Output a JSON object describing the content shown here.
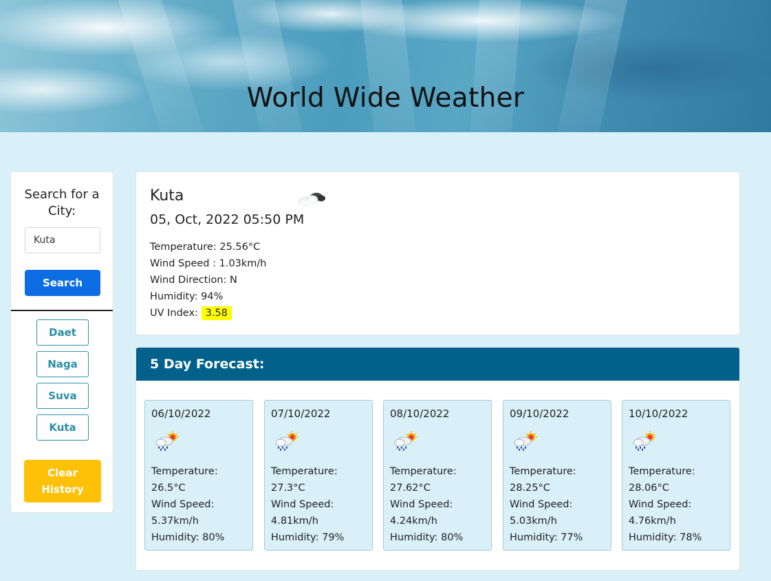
{
  "header": {
    "title": "World Wide Weather"
  },
  "sidebar": {
    "heading": "Search for a City:",
    "search_value": "Kuta",
    "search_button": "Search",
    "history": [
      "Daet",
      "Naga",
      "Suva",
      "Kuta"
    ],
    "clear_button": "Clear History"
  },
  "current": {
    "city": "Kuta",
    "date": "05, Oct, 2022 05:50 PM",
    "icon": "cloudy-icon",
    "temperature": "Temperature: 25.56°C",
    "wind_speed": "Wind Speed : 1.03km/h",
    "wind_direction": "Wind Direction: N",
    "humidity": "Humidity: 94%",
    "uv_label": "UV Index:",
    "uv_value": "3.58",
    "uv_color": "#ffff00"
  },
  "forecast": {
    "title": "5 Day Forecast:",
    "days": [
      {
        "date": "06/10/2022",
        "icon": "rain-sun-icon",
        "temp_label": "Temperature:",
        "temp": "26.5°C",
        "wind_label": "Wind Speed:",
        "wind": "5.37km/h",
        "humidity": "Humidity: 80%"
      },
      {
        "date": "07/10/2022",
        "icon": "rain-sun-icon",
        "temp_label": "Temperature:",
        "temp": "27.3°C",
        "wind_label": "Wind Speed:",
        "wind": "4.81km/h",
        "humidity": "Humidity: 79%"
      },
      {
        "date": "08/10/2022",
        "icon": "rain-sun-icon",
        "temp_label": "Temperature:",
        "temp": "27.62°C",
        "wind_label": "Wind Speed:",
        "wind": "4.24km/h",
        "humidity": "Humidity: 80%"
      },
      {
        "date": "09/10/2022",
        "icon": "rain-sun-icon",
        "temp_label": "Temperature:",
        "temp": "28.25°C",
        "wind_label": "Wind Speed:",
        "wind": "5.03km/h",
        "humidity": "Humidity: 77%"
      },
      {
        "date": "10/10/2022",
        "icon": "rain-sun-icon",
        "temp_label": "Temperature:",
        "temp": "28.06°C",
        "wind_label": "Wind Speed:",
        "wind": "4.76km/h",
        "humidity": "Humidity: 78%"
      }
    ]
  },
  "colors": {
    "page_bg": "#d9f0f8",
    "search_button": "#0d6ee3",
    "history_button": "#2a8ea3",
    "clear_button": "#ffc107",
    "forecast_header": "#02618a"
  }
}
